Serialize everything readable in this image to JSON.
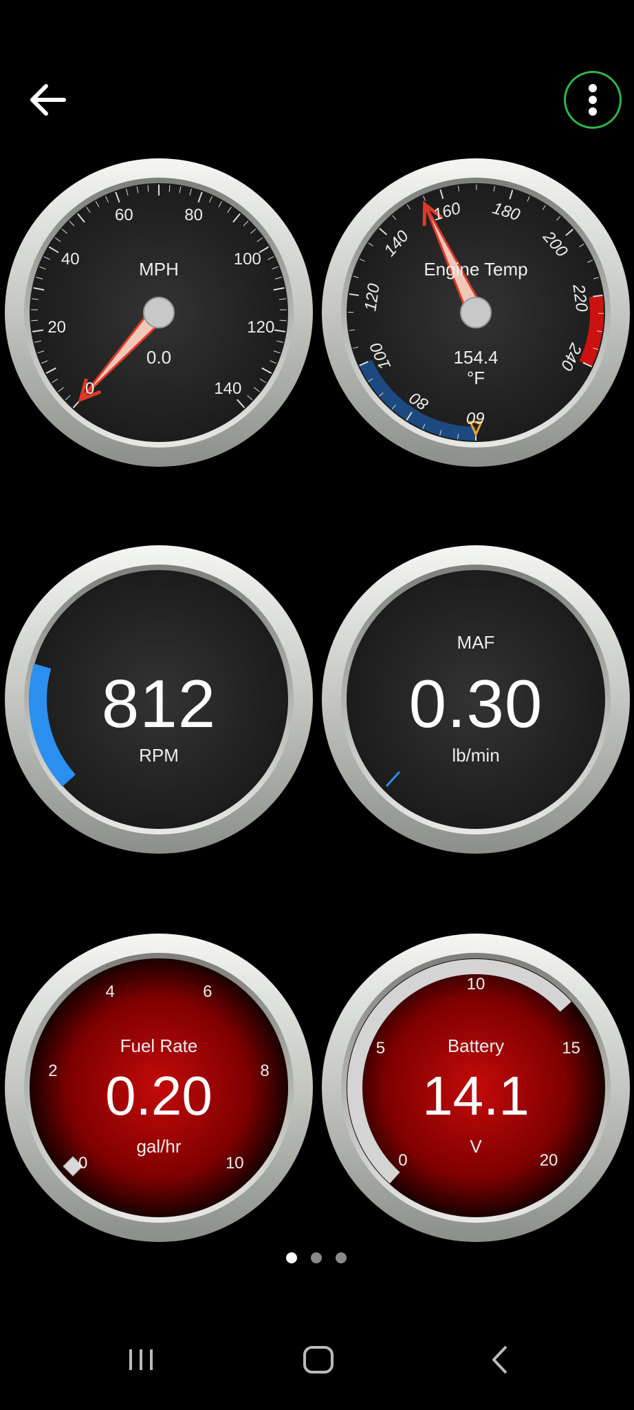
{
  "colors": {
    "background": "#000000",
    "menu_ring": "#2fb84a",
    "needle": "#e0392b",
    "cold_band": "#1c4a80",
    "hot_band": "#cc1111",
    "rpm_arc": "#2b8ff0",
    "alert_face": "#b00000"
  },
  "icons": {
    "back": "arrow-left-icon",
    "menu": "more-vertical-icon",
    "nav_recent": "recent-apps-icon",
    "nav_home": "home-icon",
    "nav_back": "chevron-left-icon"
  },
  "gauges": {
    "speed": {
      "label": "MPH",
      "value": "0.0",
      "ticks": [
        "0",
        "20",
        "40",
        "60",
        "80",
        "100",
        "120",
        "140"
      ],
      "needle_value": 0
    },
    "temp": {
      "label": "Engine Temp",
      "value": "154.4",
      "unit": "°F",
      "ticks": [
        "60",
        "80",
        "100",
        "120",
        "140",
        "160",
        "180",
        "200",
        "220",
        "240"
      ],
      "needle_value": 154.4
    },
    "rpm": {
      "value": "812",
      "unit": "RPM"
    },
    "maf": {
      "label": "MAF",
      "value": "0.30",
      "unit": "lb/min"
    },
    "fuel": {
      "label": "Fuel Rate",
      "value": "0.20",
      "unit": "gal/hr",
      "ticks": [
        "0",
        "2",
        "4",
        "6",
        "8",
        "10"
      ]
    },
    "battery": {
      "label": "Battery",
      "value": "14.1",
      "unit": "V",
      "ticks": [
        "0",
        "5",
        "10",
        "15",
        "20"
      ]
    }
  },
  "pager": {
    "pages": 3,
    "active": 1
  }
}
